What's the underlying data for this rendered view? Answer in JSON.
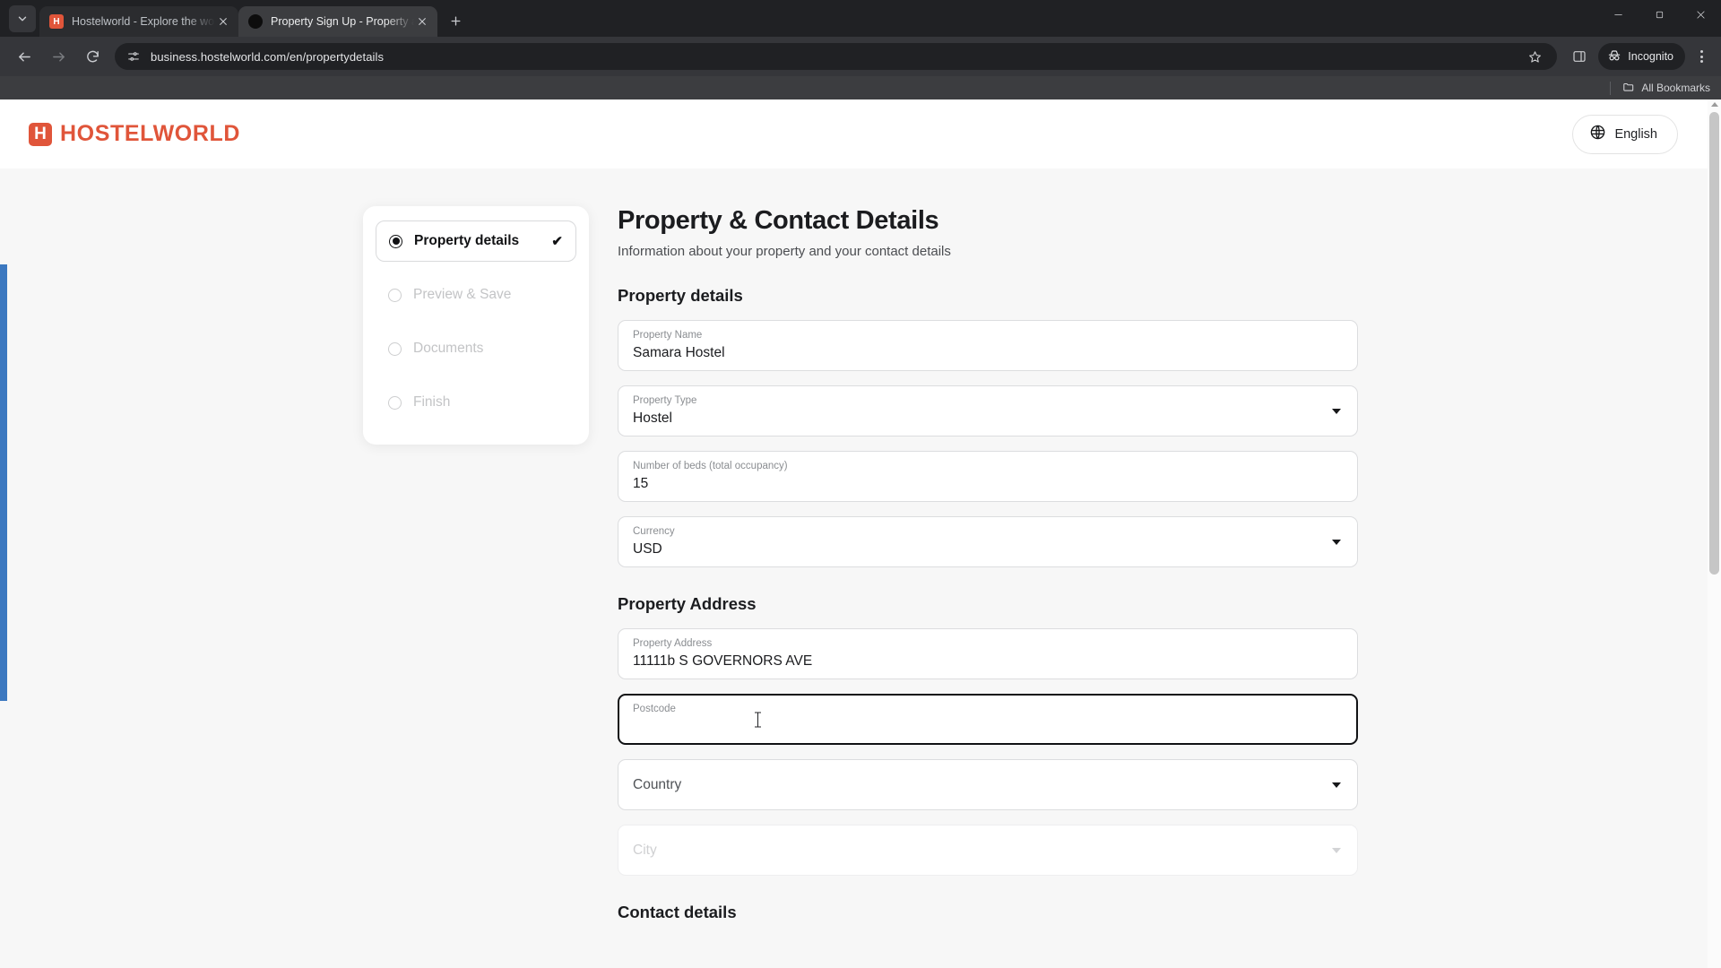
{
  "browser": {
    "tab_search_icon": "chevron-down-icon",
    "tabs": [
      {
        "title": "Hostelworld - Explore the world",
        "favicon": "hostelworld-favicon",
        "active": false
      },
      {
        "title": "Property Sign Up - Property and",
        "favicon": "dark-circle-favicon",
        "active": true
      }
    ],
    "new_tab_label": "+",
    "window_controls": {
      "minimize": "minimize-icon",
      "maximize": "maximize-icon",
      "close": "close-icon"
    },
    "toolbar": {
      "back": "back-arrow-icon",
      "forward": "forward-arrow-icon",
      "reload": "reload-icon",
      "site_info_icon": "page-settings-icon",
      "url": "business.hostelworld.com/en/propertydetails",
      "bookmark_icon": "star-icon",
      "side_panel_icon": "side-panel-icon",
      "incognito_label": "Incognito",
      "incognito_icon": "incognito-icon",
      "menu_icon": "three-dots-icon"
    },
    "bookmarks_bar": {
      "all_bookmarks_label": "All Bookmarks",
      "folder_icon": "folder-icon"
    }
  },
  "header": {
    "logo_mark": "H",
    "logo_text": "HOSTELWORLD",
    "logo_color": "#e0553a",
    "language_label": "English",
    "language_icon": "globe-icon"
  },
  "stepper": {
    "steps": [
      {
        "label": "Property details",
        "state": "active",
        "check": "✔"
      },
      {
        "label": "Preview & Save",
        "state": "pending",
        "check": ""
      },
      {
        "label": "Documents",
        "state": "pending",
        "check": ""
      },
      {
        "label": "Finish",
        "state": "pending",
        "check": ""
      }
    ]
  },
  "form": {
    "title": "Property & Contact Details",
    "subtitle": "Information about your property and your contact details",
    "section_property": "Property details",
    "section_address": "Property Address",
    "section_contact": "Contact details",
    "fields": {
      "property_name": {
        "label": "Property Name",
        "value": "Samara Hostel"
      },
      "property_type": {
        "label": "Property Type",
        "value": "Hostel"
      },
      "beds": {
        "label": "Number of beds (total occupancy)",
        "value": "15"
      },
      "currency": {
        "label": "Currency",
        "value": "USD"
      },
      "address": {
        "label": "Property Address",
        "value": "11111b S GOVERNORS AVE"
      },
      "postcode": {
        "label": "Postcode",
        "value": ""
      },
      "country": {
        "label": "Country",
        "value": ""
      },
      "city": {
        "label": "City",
        "value": ""
      }
    }
  }
}
